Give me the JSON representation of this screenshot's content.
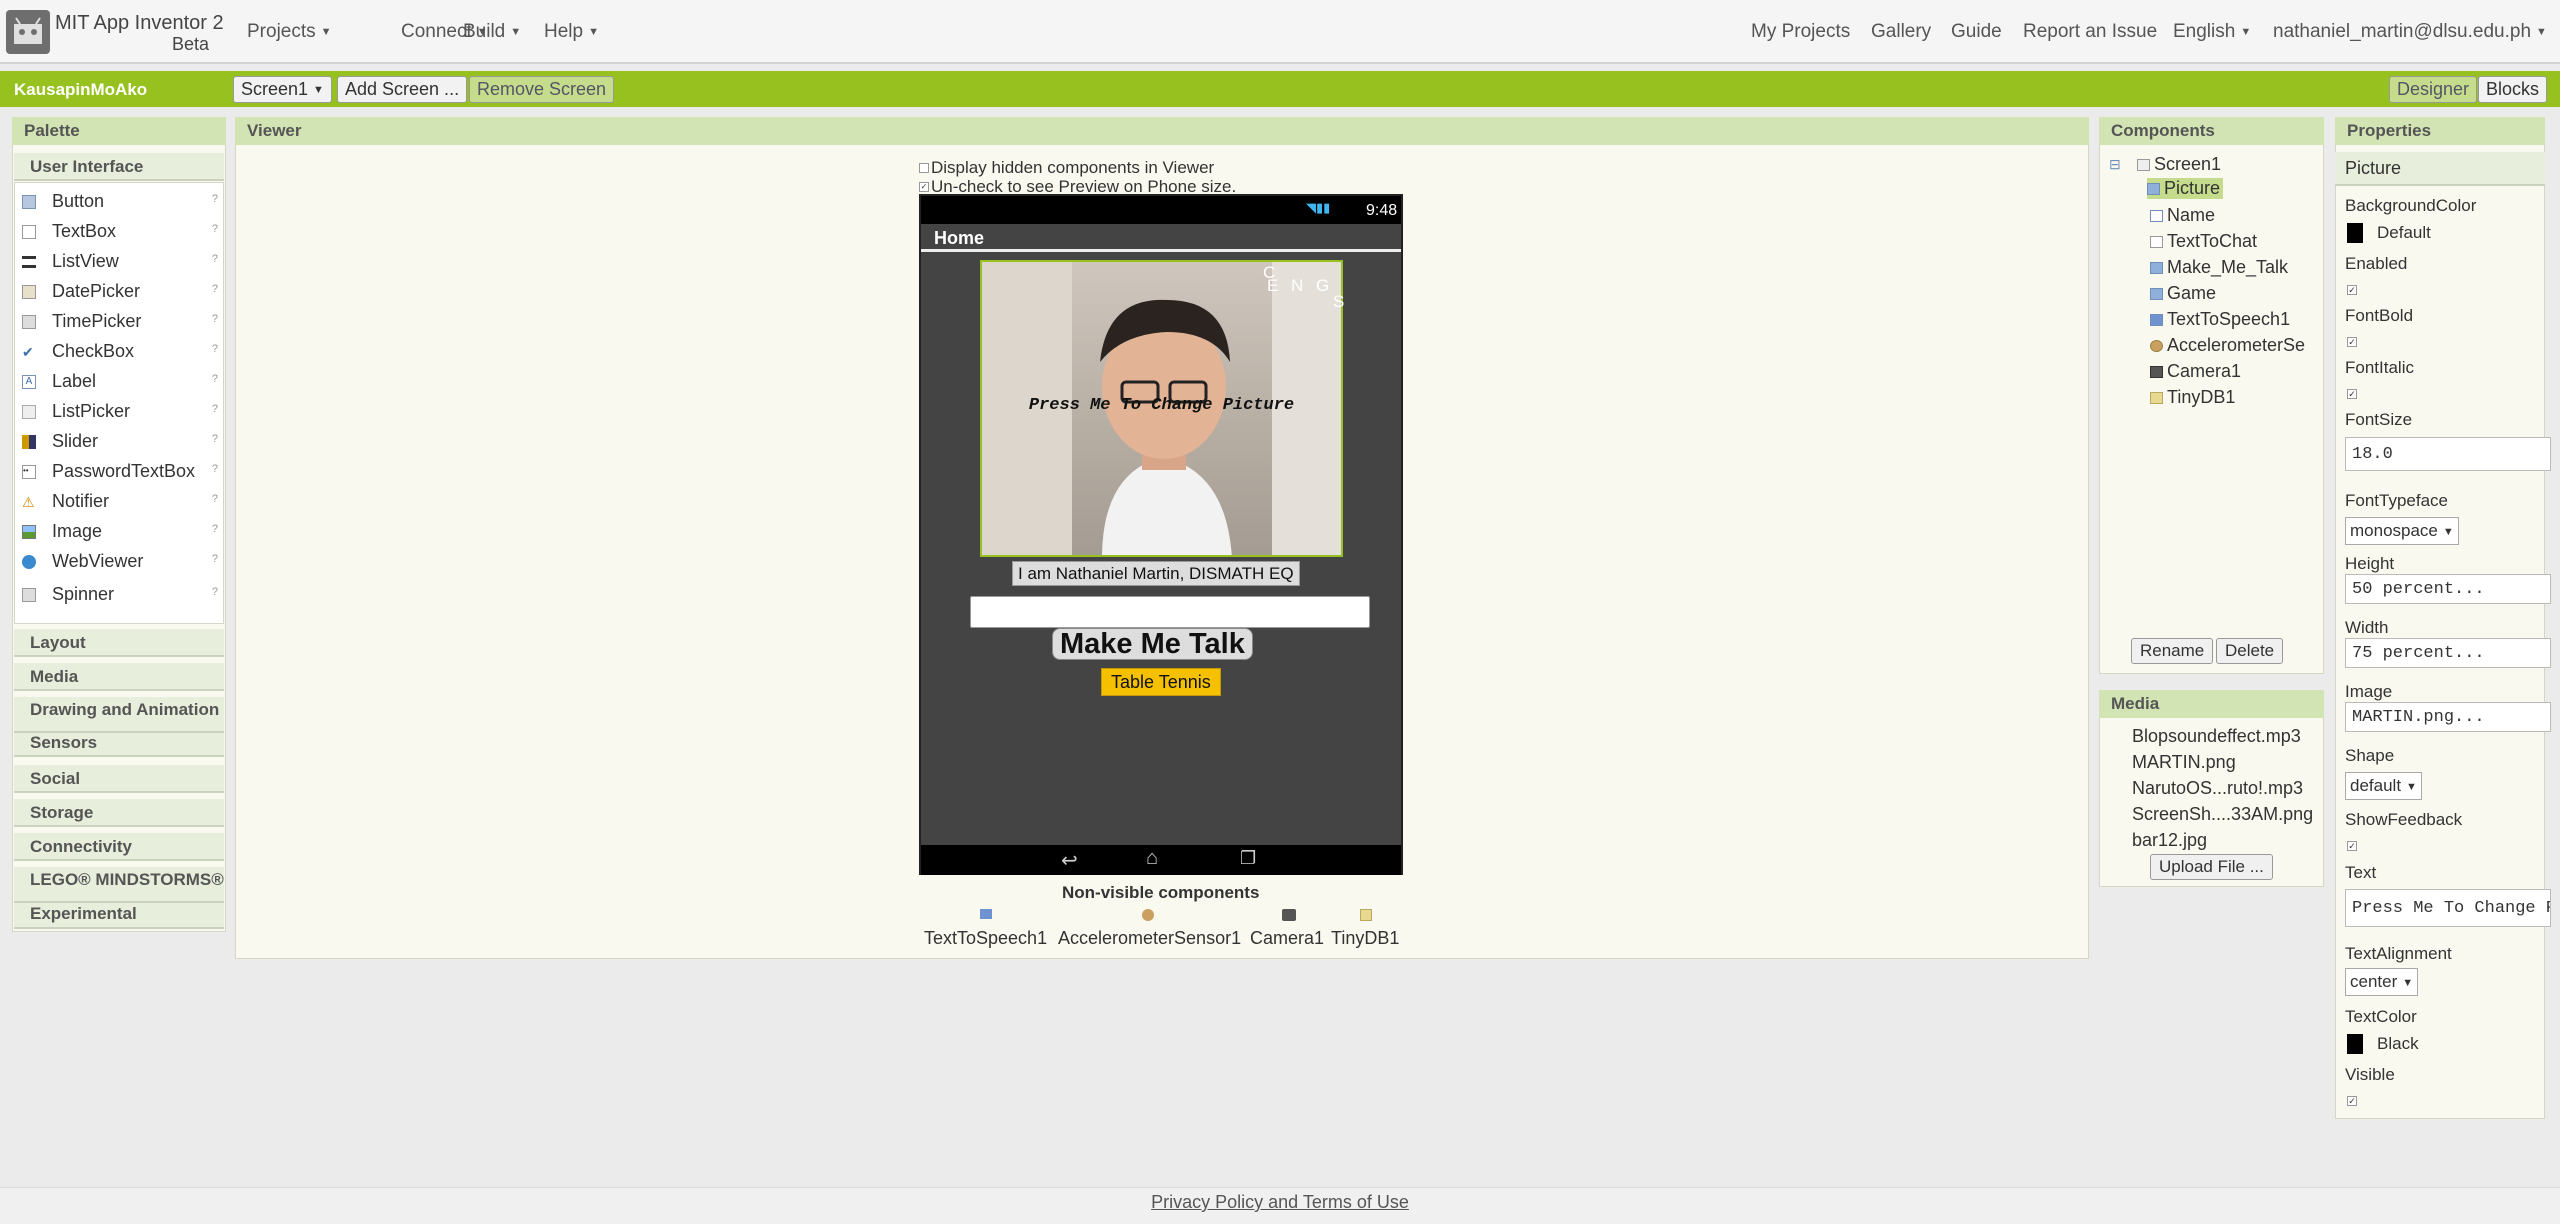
{
  "app": {
    "title_line1": "MIT App Inventor 2",
    "title_line2": "Beta"
  },
  "nav_left": [
    "Projects",
    "Connect",
    "Build",
    "Help"
  ],
  "nav_right": [
    "My Projects",
    "Gallery",
    "Guide",
    "Report an Issue",
    "English",
    "nathaniel_martin@dlsu.edu.ph"
  ],
  "project": {
    "name": "KausapinMoAko",
    "screen_select": "Screen1",
    "add_screen": "Add Screen ...",
    "remove_screen": "Remove Screen",
    "designer": "Designer",
    "blocks": "Blocks"
  },
  "palette": {
    "title": "Palette",
    "categories": [
      "User Interface",
      "Layout",
      "Media",
      "Drawing and Animation",
      "Sensors",
      "Social",
      "Storage",
      "Connectivity",
      "LEGO® MINDSTORMS®",
      "Experimental"
    ],
    "items": [
      "Button",
      "TextBox",
      "ListView",
      "DatePicker",
      "TimePicker",
      "CheckBox",
      "Label",
      "ListPicker",
      "Slider",
      "PasswordTextBox",
      "Notifier",
      "Image",
      "WebViewer",
      "Spinner"
    ],
    "help": "?"
  },
  "viewer": {
    "title": "Viewer",
    "checkbox_hidden": "Display hidden components in Viewer",
    "checkbox_preview": "Un-check to see Preview on Phone size.",
    "status_time": "9:48",
    "screen_title": "Home",
    "picture_text": "Press Me To Change Picture",
    "bg_letters_1": "C",
    "bg_letters_2": "E N G",
    "bg_letters_3": "S",
    "name_label": "I am Nathaniel Martin, DISMATH EQ",
    "textbox_value": "",
    "make_me_talk": "Make Me Talk",
    "game_button": "Table Tennis",
    "nonvisible_title": "Non-visible components",
    "nonvisible": [
      "TextToSpeech1",
      "AccelerometerSensor1",
      "Camera1",
      "TinyDB1"
    ]
  },
  "components": {
    "title": "Components",
    "root": "Screen1",
    "collapse": "⊟",
    "items": [
      "Picture",
      "Name",
      "TextToChat",
      "Make_Me_Talk",
      "Game",
      "TextToSpeech1",
      "AccelerometerSe",
      "Camera1",
      "TinyDB1"
    ],
    "rename": "Rename",
    "delete": "Delete"
  },
  "media": {
    "title": "Media",
    "files": [
      "Blopsoundeffect.mp3",
      "MARTIN.png",
      "NarutoOS...ruto!.mp3",
      "ScreenSh....33AM.png",
      "bar12.jpg"
    ],
    "upload": "Upload File ..."
  },
  "properties": {
    "title": "Properties",
    "component": "Picture",
    "background_color_label": "BackgroundColor",
    "background_color": "Default",
    "enabled_label": "Enabled",
    "fontbold_label": "FontBold",
    "fontitalic_label": "FontItalic",
    "fontsize_label": "FontSize",
    "fontsize": "18.0",
    "fonttypeface_label": "FontTypeface",
    "fonttypeface": "monospace",
    "height_label": "Height",
    "height": "50 percent...",
    "width_label": "Width",
    "width": "75 percent...",
    "image_label": "Image",
    "image": "MARTIN.png...",
    "shape_label": "Shape",
    "shape": "default",
    "showfeedback_label": "ShowFeedback",
    "text_label": "Text",
    "text": "Press Me To Change P",
    "textalignment_label": "TextAlignment",
    "textalignment": "center",
    "textcolor_label": "TextColor",
    "textcolor": "Black",
    "visible_label": "Visible",
    "check": "✓"
  },
  "footer": {
    "link": "Privacy Policy and Terms of Use"
  },
  "colors": {
    "accent_green": "#96c11f",
    "panel_header": "#d3e4b4",
    "game_button": "#f5c000"
  }
}
